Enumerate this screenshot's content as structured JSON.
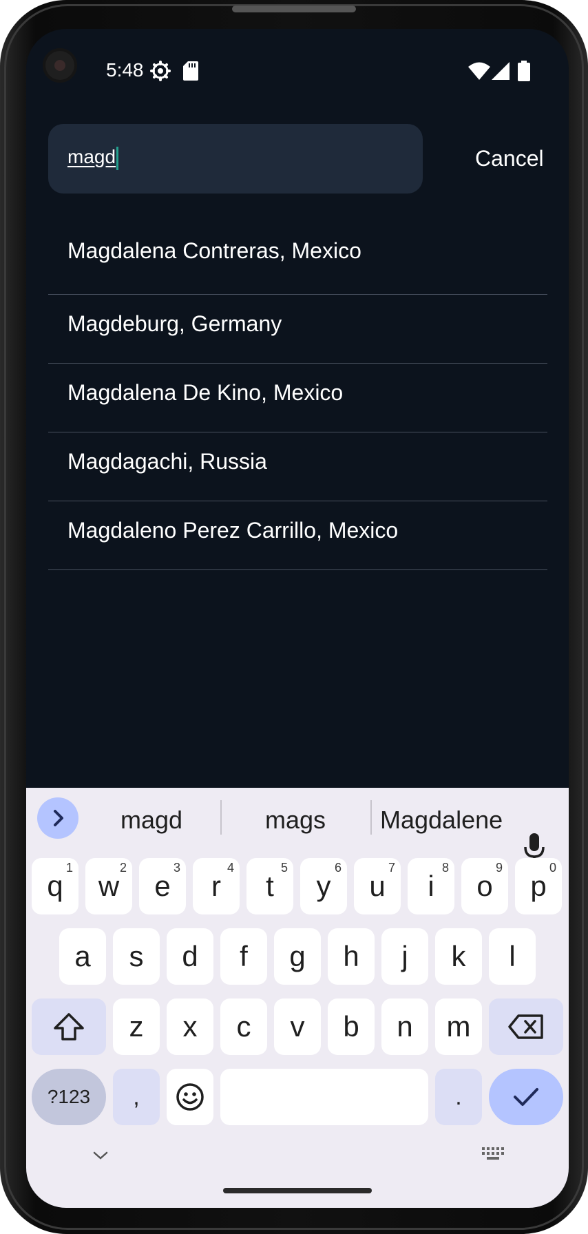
{
  "status_bar": {
    "time": "5:48",
    "icons": [
      "settings-icon",
      "sd-card-icon",
      "wifi-icon",
      "cell-signal-icon",
      "battery-icon"
    ]
  },
  "search": {
    "value": "magd",
    "cancel_label": "Cancel"
  },
  "results": [
    "Magdalena Contreras, Mexico",
    "Magdeburg, Germany",
    "Magdalena De Kino, Mexico",
    "Magdagachi, Russia",
    "Magdaleno Perez Carrillo, Mexico"
  ],
  "keyboard": {
    "suggestions": [
      "magd",
      "mags",
      "Magdalene"
    ],
    "row1": [
      {
        "key": "q",
        "hint": "1"
      },
      {
        "key": "w",
        "hint": "2"
      },
      {
        "key": "e",
        "hint": "3"
      },
      {
        "key": "r",
        "hint": "4"
      },
      {
        "key": "t",
        "hint": "5"
      },
      {
        "key": "y",
        "hint": "6"
      },
      {
        "key": "u",
        "hint": "7"
      },
      {
        "key": "i",
        "hint": "8"
      },
      {
        "key": "o",
        "hint": "9"
      },
      {
        "key": "p",
        "hint": "0"
      }
    ],
    "row2": [
      "a",
      "s",
      "d",
      "f",
      "g",
      "h",
      "j",
      "k",
      "l"
    ],
    "row3": [
      "z",
      "x",
      "c",
      "v",
      "b",
      "n",
      "m"
    ],
    "symbols_label": "?123",
    "comma_label": ",",
    "period_label": "."
  },
  "colors": {
    "screen_bg": "#0c131d",
    "search_bg": "#1f2a3a",
    "keyboard_bg": "#eeebf3",
    "accent_key": "#b4c4ff"
  }
}
